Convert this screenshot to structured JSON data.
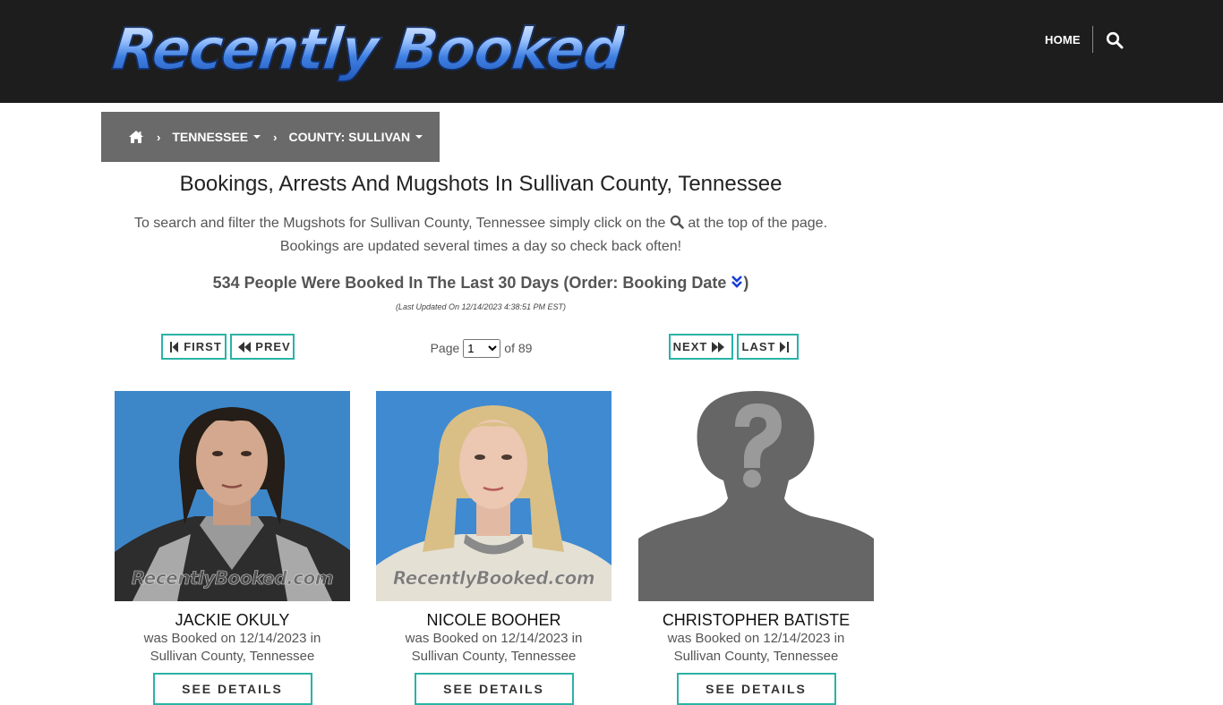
{
  "header": {
    "logo_text": "Recently Booked",
    "nav_home": "HOME",
    "search_icon": "search-icon",
    "background_color": "#1d1d1d"
  },
  "breadcrumb": {
    "home_icon": "home-icon",
    "state": "TENNESSEE",
    "county": "COUNTY: SULLIVAN"
  },
  "page": {
    "title": "Bookings, Arrests And Mugshots In Sullivan County, Tennessee",
    "intro_before_icon": "To search and filter the Mugshots for Sullivan County, Tennessee simply click on the",
    "intro_after_icon": "at the top of the page.",
    "intro_line2": "Bookings are updated several times a day so check back often!",
    "count_text": "534 People Were Booked In The Last 30 Days (Order: Booking Date",
    "count_close": ")",
    "last_updated": "(Last Updated On 12/14/2023 4:38:51 PM EST)"
  },
  "pagination": {
    "first": "FIRST",
    "prev": "PREV",
    "next": "NEXT",
    "last": "LAST",
    "page_label": "Page",
    "current_page": "1",
    "of_label": "of 89",
    "accent_color": "#2ab3a6"
  },
  "watermark": "RecentlyBooked.com",
  "bookings": [
    {
      "name": "JACKIE OKULY",
      "line1": "was Booked on 12/14/2023 in",
      "line2": "Sullivan County, Tennessee",
      "button": "SEE DETAILS"
    },
    {
      "name": "NICOLE BOOHER",
      "line1": "was Booked on 12/14/2023 in",
      "line2": "Sullivan County, Tennessee",
      "button": "SEE DETAILS"
    },
    {
      "name": "CHRISTOPHER BATISTE",
      "line1": "was Booked on 12/14/2023 in",
      "line2": "Sullivan County, Tennessee",
      "button": "SEE DETAILS"
    }
  ]
}
